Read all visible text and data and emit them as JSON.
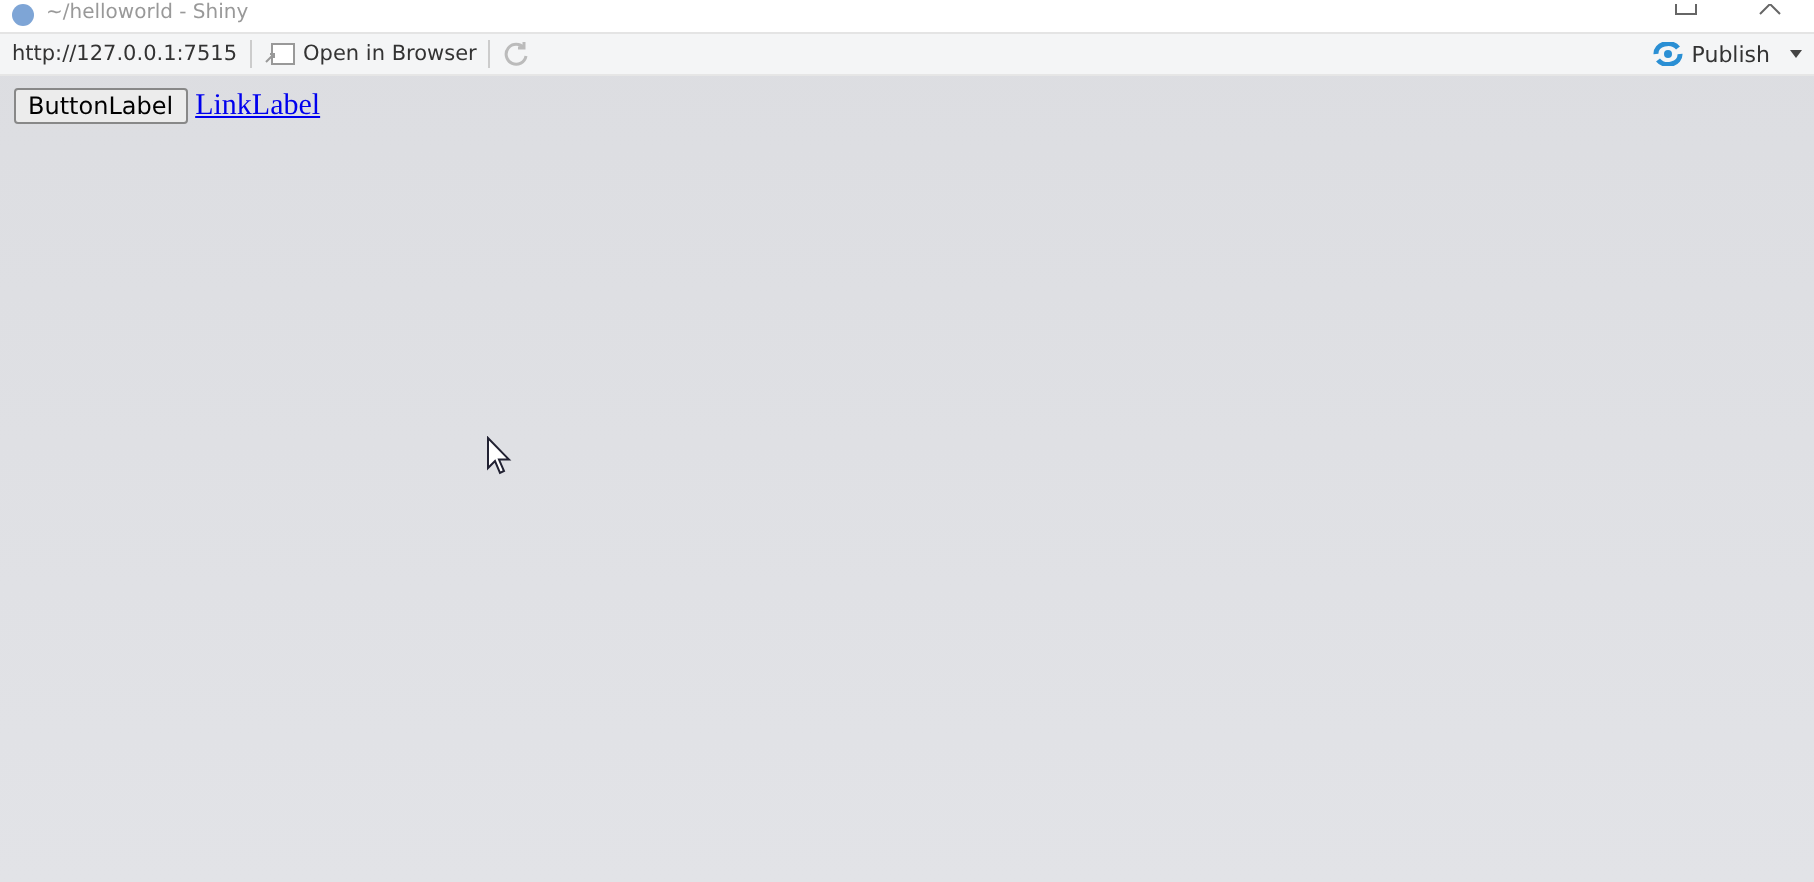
{
  "window": {
    "title": "~/helloworld - Shiny"
  },
  "toolbar": {
    "url": "http://127.0.0.1:7515",
    "open_in_browser": "Open in Browser",
    "publish": "Publish"
  },
  "content": {
    "button": "ButtonLabel",
    "link": "LinkLabel"
  }
}
